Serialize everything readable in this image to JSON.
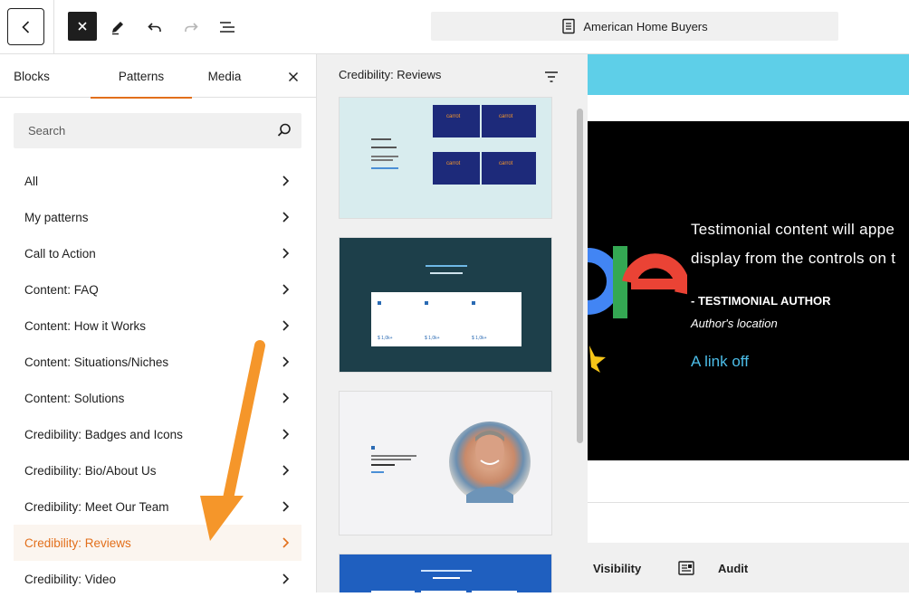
{
  "toolbar": {
    "back_icon": "chevron-left-icon",
    "close_icon": "close-icon",
    "edit_icon": "pencil-icon",
    "undo_icon": "undo-icon",
    "redo_icon": "redo-icon",
    "outline_icon": "list-view-icon",
    "document_title": "American Home Buyers",
    "document_icon": "page-icon"
  },
  "sidebar": {
    "tabs": [
      {
        "label": "Blocks"
      },
      {
        "label": "Patterns"
      },
      {
        "label": "Media"
      }
    ],
    "active_tab": "Patterns",
    "search_placeholder": "Search",
    "categories": [
      {
        "label": "All"
      },
      {
        "label": "My patterns"
      },
      {
        "label": "Call to Action"
      },
      {
        "label": "Content: FAQ"
      },
      {
        "label": "Content: How it Works"
      },
      {
        "label": "Content: Situations/Niches"
      },
      {
        "label": "Content: Solutions"
      },
      {
        "label": "Credibility: Badges and Icons"
      },
      {
        "label": "Credibility: Bio/About Us"
      },
      {
        "label": "Credibility: Meet Our Team"
      },
      {
        "label": "Credibility: Reviews"
      },
      {
        "label": "Credibility: Video"
      }
    ],
    "active_category": "Credibility: Reviews"
  },
  "previews": {
    "heading": "Credibility: Reviews",
    "card1": {
      "video_label_1": "carrot",
      "video_label_2": "Video",
      "video_label_3": "Placeholder"
    },
    "card2": {
      "title": "Real Client Reviews",
      "amount": "$ 1,0k+"
    },
    "card3": {
      "caption": "Testimonials"
    },
    "card4": {
      "title": "Real Sellers"
    }
  },
  "canvas": {
    "hero_line_1": "Testimonial content will appe",
    "hero_line_2": "display from the controls on t",
    "author": "- TESTIMONIAL AUTHOR",
    "location": "Author's location",
    "link": "A link off",
    "logo_fragment": "gle",
    "bottom_items": [
      "Visibility",
      "Audit"
    ]
  },
  "colors": {
    "accent": "#e26f1b",
    "cyan": "#5ecfe8",
    "link": "#4cbde8",
    "arrow": "#f5962a"
  }
}
